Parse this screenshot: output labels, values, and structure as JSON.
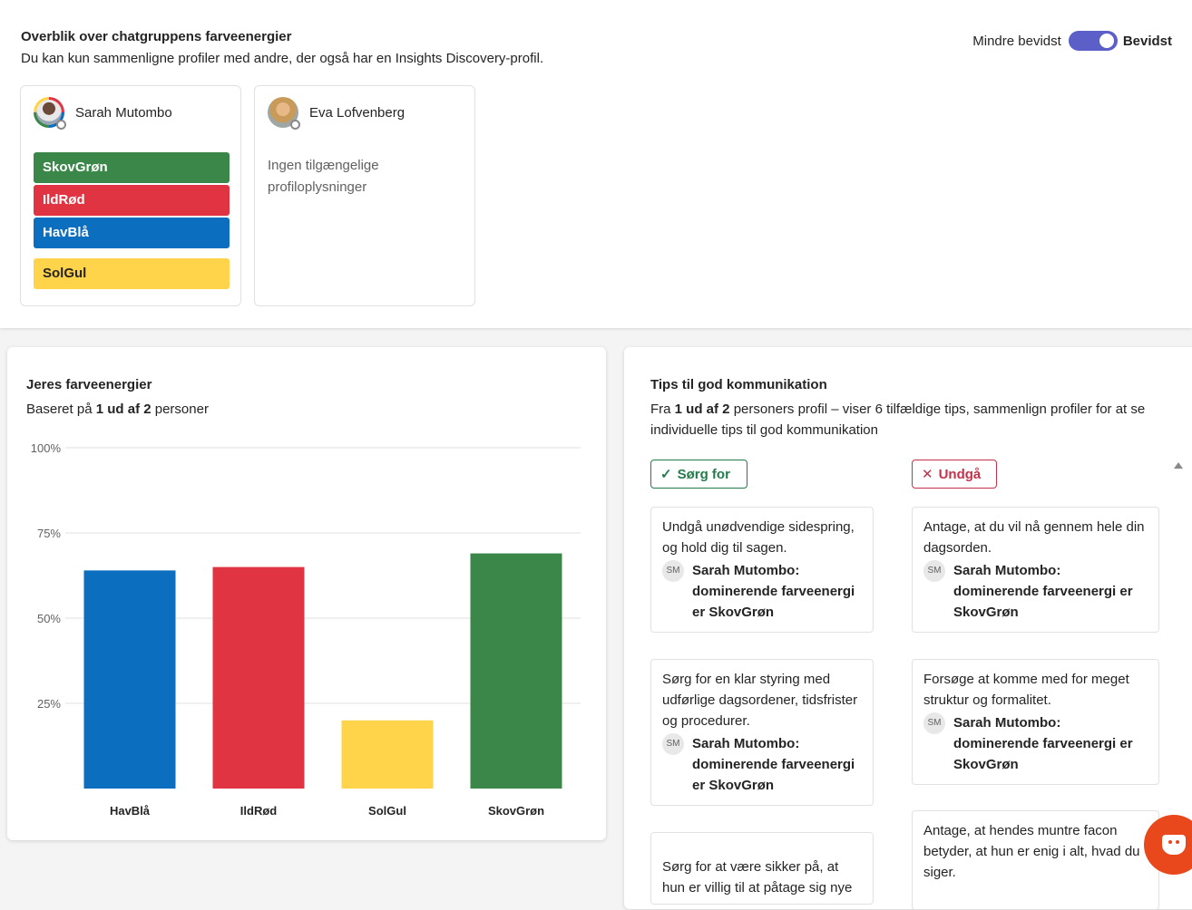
{
  "overview": {
    "title": "Overblik over chatgruppens farveenergier",
    "subtitle": "Du kan kun sammenligne profiler med andre, der også har en Insights Discovery-profil.",
    "toggle_left": "Mindre bevidst",
    "toggle_right": "Bevidst",
    "people": [
      {
        "name": "Sarah Mutombo",
        "colors": [
          "SkovGrøn",
          "IldRød",
          "HavBlå",
          "SolGul"
        ]
      },
      {
        "name": "Eva Lofvenberg",
        "no_info": "Ingen tilgængelige profiloplysninger"
      }
    ]
  },
  "colors": {
    "green": "#3b874a",
    "red": "#e03442",
    "blue": "#0c6ebf",
    "yellow": "#ffd44a"
  },
  "energies": {
    "title": "Jeres farveenergier",
    "sub_prefix": "Baseret på ",
    "sub_bold": "1 ud af 2",
    "sub_suffix": " personer"
  },
  "chart_data": {
    "type": "bar",
    "categories": [
      "HavBlå",
      "IldRød",
      "SolGul",
      "SkovGrøn"
    ],
    "values": [
      64,
      65,
      20,
      69
    ],
    "colors": [
      "#0c6ebf",
      "#e03442",
      "#ffd44a",
      "#3b874a"
    ],
    "yticks": [
      "25%",
      "50%",
      "75%",
      "100%"
    ],
    "ylim": [
      0,
      100
    ],
    "grid": true
  },
  "tips": {
    "title": "Tips til god kommunikation",
    "sub_prefix": "Fra ",
    "sub_bold": "1 ud af 2",
    "sub_suffix": " personers profil – viser 6 tilfældige tips, sammenlign profiler for at se individuelle tips til god kommunikation",
    "do_label": "Sørg for",
    "avoid_label": "Undgå",
    "do_items": [
      {
        "text": "Undgå unødvendige sidespring, og hold dig til sagen.",
        "initials": "SM",
        "source": "Sarah Mutombo: dominerende farveenergi er SkovGrøn"
      },
      {
        "text": "Sørg for en klar styring med udførlige dagsordener, tidsfrister og procedurer.",
        "initials": "SM",
        "source": "Sarah Mutombo: dominerende farveenergi er SkovGrøn"
      },
      {
        "text": "Sørg for at være sikker på, at hun er villig til at påtage sig nye"
      }
    ],
    "avoid_items": [
      {
        "text": "Antage, at du vil nå gennem hele din dagsorden.",
        "initials": "SM",
        "source": "Sarah Mutombo: dominerende farveenergi er SkovGrøn"
      },
      {
        "text": "Forsøge at komme med for meget struktur og formalitet.",
        "initials": "SM",
        "source": "Sarah Mutombo: dominerende farveenergi er SkovGrøn"
      },
      {
        "text": "Antage, at hendes muntre facon betyder, at hun er enig i alt, hvad du siger."
      }
    ]
  }
}
